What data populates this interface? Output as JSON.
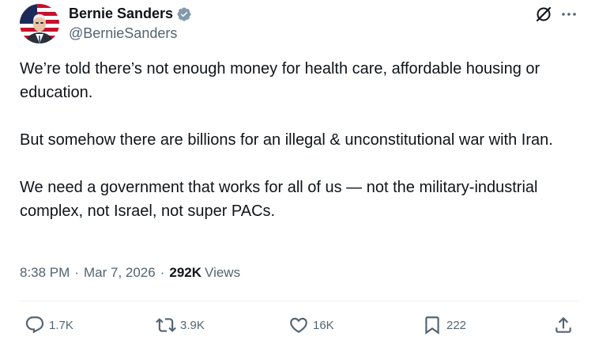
{
  "author": {
    "display_name": "Bernie Sanders",
    "handle": "@BernieSanders",
    "verified": true
  },
  "tweet": {
    "paragraphs": [
      "We’re told there’s not enough money for health care, affordable housing or education.",
      "But somehow there are billions for an illegal & unconstitutional war with Iran.",
      "We need a government that works for all of us — not the military-industrial complex, not Israel, not super PACs."
    ],
    "time": "8:38 PM",
    "date": "Mar 7, 2026",
    "separator": "·",
    "views_count": "292K",
    "views_label": "Views"
  },
  "actions": {
    "replies": "1.7K",
    "reposts": "3.9K",
    "likes": "16K",
    "bookmarks": "222"
  },
  "colors": {
    "text": "#0f1419",
    "secondary": "#536471",
    "verified_badge": "#829aab",
    "divider": "#eff3f4"
  }
}
